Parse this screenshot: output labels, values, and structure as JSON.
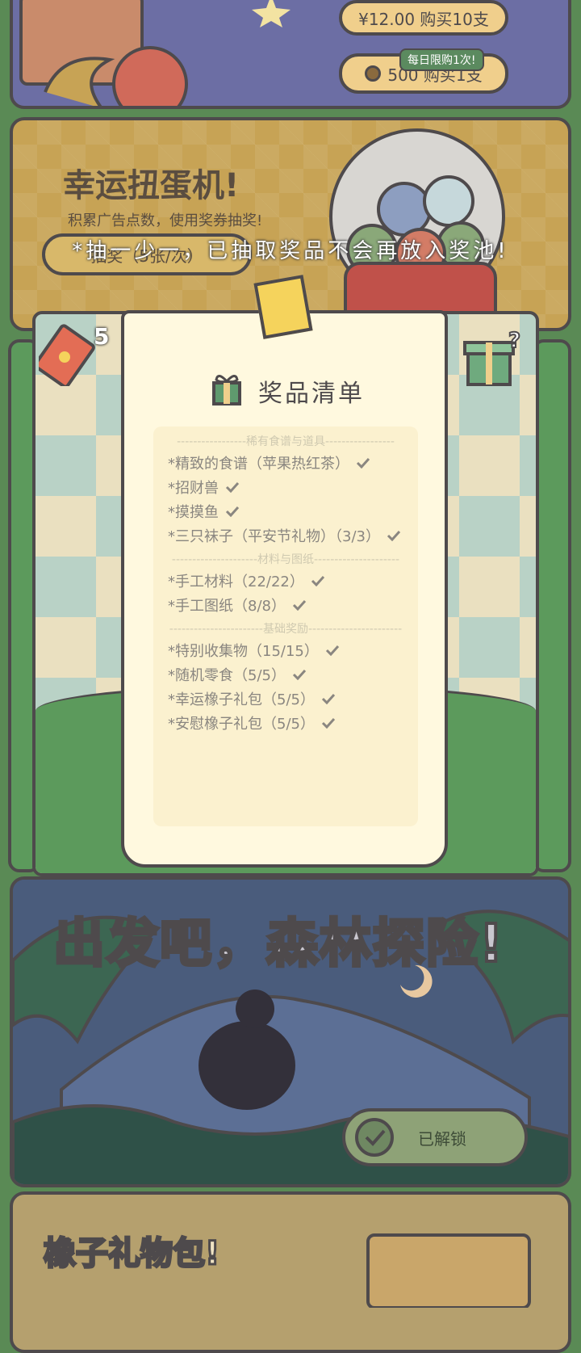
{
  "shop": {
    "buy10_label": "¥12.00 购买10支",
    "daily_limit_tag": "每日限购1次!",
    "buy1_label": "500 购买1支"
  },
  "gacha": {
    "title": "幸运扭蛋机!",
    "description": "积累广告点数，使用奖券抽奖!",
    "draw_button": "抽奖（5张/次）",
    "notice": "*抽一少一，已抽取奖品不会再放入奖池!",
    "ticket_count": "5"
  },
  "prize_list": {
    "title": "奖品清单",
    "sections": [
      {
        "header": "稀有食谱与道具",
        "items": [
          "*精致的食谱（苹果热红茶）",
          "*招财兽",
          "*摸摸鱼",
          "*三只袜子（平安节礼物）（3/3）"
        ]
      },
      {
        "header": "材料与图纸",
        "items": [
          "*手工材料（22/22）",
          "*手工图纸（8/8）"
        ]
      },
      {
        "header": "基础奖励",
        "items": [
          "*特别收集物（15/15）",
          "*随机零食（5/5）",
          "*幸运橡子礼包（5/5）",
          "*安慰橡子礼包（5/5）"
        ]
      }
    ]
  },
  "forest": {
    "title": "出发吧，森林探险!",
    "unlocked_label": "已解锁"
  },
  "bottom": {
    "title": "橡子礼物包!"
  },
  "colors": {
    "outline": "#4e4a4c",
    "paper": "#fff9df",
    "grass": "#5c9a5c",
    "gold": "#f0cf8c"
  }
}
